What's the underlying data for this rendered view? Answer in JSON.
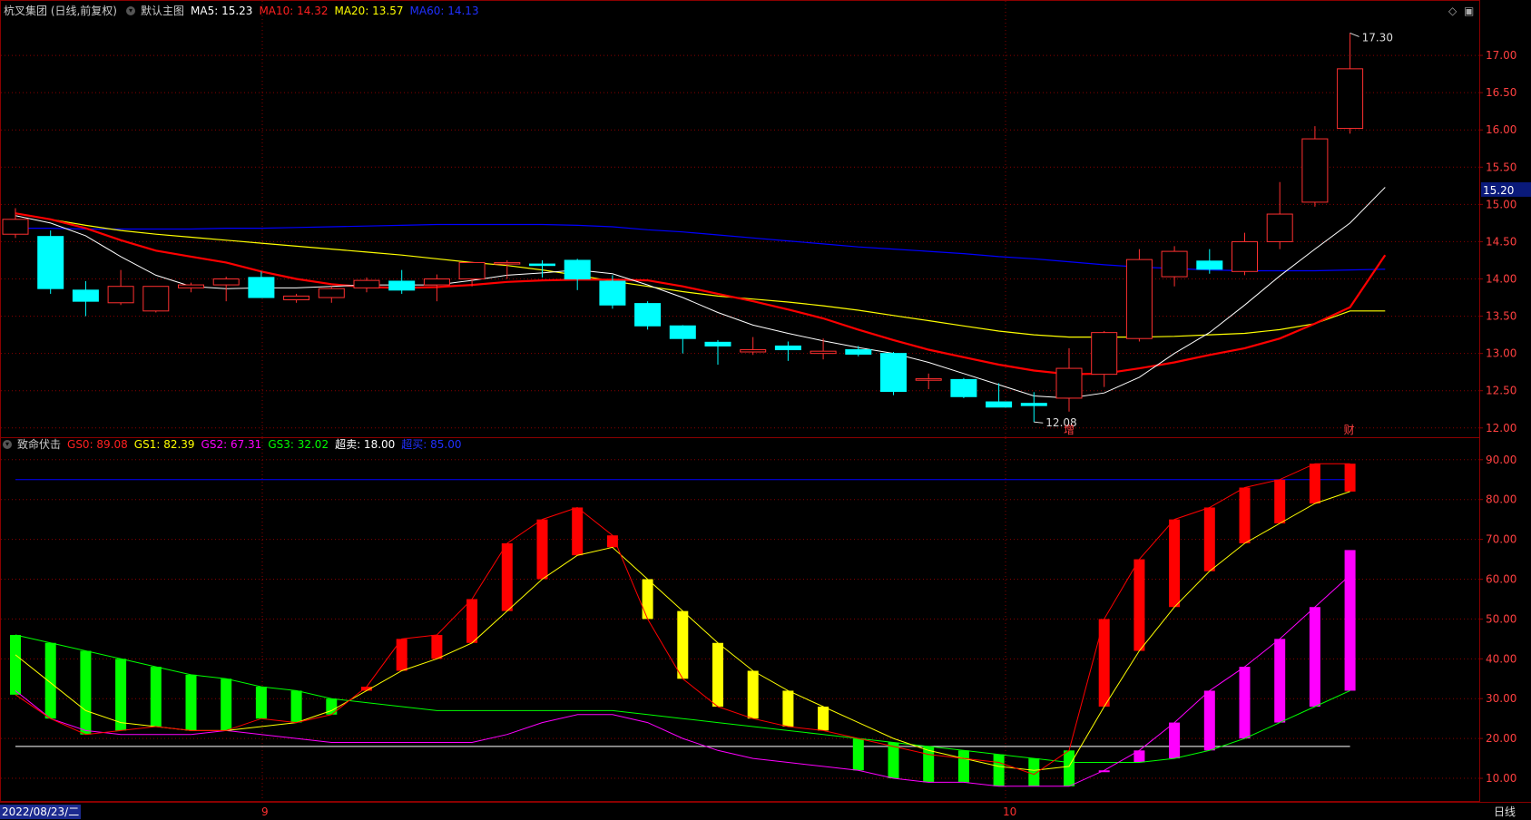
{
  "main_header": {
    "title": "杭叉集团 (日线,前复权)",
    "mode": "默认主图",
    "ma5": "MA5: 15.23",
    "ma10": "MA10: 14.32",
    "ma20": "MA20: 13.57",
    "ma60": "MA60: 14.13"
  },
  "sub_header": {
    "title": "致命伏击",
    "gs0": "GS0: 89.08",
    "gs1": "GS1: 82.39",
    "gs2": "GS2: 67.31",
    "gs3": "GS3: 32.02",
    "oversold": "超卖: 18.00",
    "overbought": "超买: 85.00"
  },
  "bottom": {
    "date_label": "2022/08/23/二",
    "month_9": "9",
    "month_10": "10",
    "period": "日线"
  },
  "colors": {
    "up": "#ff3030",
    "down": "#00ffff",
    "ma5": "#ffffff",
    "ma10": "#ff0000",
    "ma20": "#ffff00",
    "ma60": "#0000ff",
    "gs_green": "#00ff00",
    "gs_yellow": "#ffff00",
    "gs_red": "#ff0000",
    "gs_magenta": "#ff00ff",
    "grid": "#8a0000"
  },
  "chart_data": {
    "type": "candlestick",
    "price_axis": {
      "ticks": [
        "12.00",
        "12.50",
        "13.00",
        "13.50",
        "14.00",
        "14.50",
        "15.00",
        "15.50",
        "16.00",
        "16.50",
        "17.00"
      ],
      "range": [
        11.9,
        17.5
      ],
      "current_price_tag": "15.20",
      "high_label": "17.30",
      "low_label": "12.08",
      "markers": [
        "增",
        "财"
      ]
    },
    "candles": [
      {
        "o": 14.6,
        "h": 14.95,
        "l": 14.55,
        "c": 14.8
      },
      {
        "o": 14.57,
        "h": 14.65,
        "l": 13.8,
        "c": 13.87
      },
      {
        "o": 13.85,
        "h": 13.97,
        "l": 13.5,
        "c": 13.7
      },
      {
        "o": 13.68,
        "h": 14.12,
        "l": 13.65,
        "c": 13.9
      },
      {
        "o": 13.57,
        "h": 13.9,
        "l": 13.55,
        "c": 13.9
      },
      {
        "o": 13.88,
        "h": 13.95,
        "l": 13.82,
        "c": 13.92
      },
      {
        "o": 13.92,
        "h": 14.03,
        "l": 13.7,
        "c": 14.0
      },
      {
        "o": 14.02,
        "h": 14.1,
        "l": 13.75,
        "c": 13.75
      },
      {
        "o": 13.72,
        "h": 13.8,
        "l": 13.68,
        "c": 13.77
      },
      {
        "o": 13.75,
        "h": 13.9,
        "l": 13.68,
        "c": 13.87
      },
      {
        "o": 13.88,
        "h": 14.02,
        "l": 13.82,
        "c": 13.98
      },
      {
        "o": 13.97,
        "h": 14.12,
        "l": 13.8,
        "c": 13.85
      },
      {
        "o": 13.92,
        "h": 14.06,
        "l": 13.7,
        "c": 14.0
      },
      {
        "o": 14.0,
        "h": 14.23,
        "l": 13.9,
        "c": 14.22
      },
      {
        "o": 14.2,
        "h": 14.25,
        "l": 14.0,
        "c": 14.22
      },
      {
        "o": 14.2,
        "h": 14.25,
        "l": 14.02,
        "c": 14.18
      },
      {
        "o": 14.25,
        "h": 14.27,
        "l": 13.85,
        "c": 14.0
      },
      {
        "o": 13.97,
        "h": 14.05,
        "l": 13.6,
        "c": 13.65
      },
      {
        "o": 13.67,
        "h": 13.7,
        "l": 13.32,
        "c": 13.37
      },
      {
        "o": 13.37,
        "h": 13.38,
        "l": 13.0,
        "c": 13.2
      },
      {
        "o": 13.15,
        "h": 13.18,
        "l": 12.85,
        "c": 13.1
      },
      {
        "o": 13.02,
        "h": 13.22,
        "l": 12.98,
        "c": 13.05
      },
      {
        "o": 13.1,
        "h": 13.16,
        "l": 12.9,
        "c": 13.05
      },
      {
        "o": 13.0,
        "h": 13.2,
        "l": 12.92,
        "c": 13.03
      },
      {
        "o": 13.05,
        "h": 13.1,
        "l": 12.96,
        "c": 12.99
      },
      {
        "o": 13.0,
        "h": 13.02,
        "l": 12.44,
        "c": 12.49
      },
      {
        "o": 12.64,
        "h": 12.73,
        "l": 12.52,
        "c": 12.66
      },
      {
        "o": 12.65,
        "h": 12.67,
        "l": 12.4,
        "c": 12.42
      },
      {
        "o": 12.35,
        "h": 12.6,
        "l": 12.28,
        "c": 12.28
      },
      {
        "o": 12.33,
        "h": 12.48,
        "l": 12.08,
        "c": 12.3
      },
      {
        "o": 12.4,
        "h": 13.07,
        "l": 12.22,
        "c": 12.8
      },
      {
        "o": 12.72,
        "h": 13.3,
        "l": 12.55,
        "c": 13.28
      },
      {
        "o": 13.2,
        "h": 14.4,
        "l": 13.16,
        "c": 14.26
      },
      {
        "o": 14.03,
        "h": 14.44,
        "l": 13.9,
        "c": 14.37
      },
      {
        "o": 14.24,
        "h": 14.4,
        "l": 14.07,
        "c": 14.13
      },
      {
        "o": 14.1,
        "h": 14.62,
        "l": 14.05,
        "c": 14.5
      },
      {
        "o": 14.5,
        "h": 15.3,
        "l": 14.4,
        "c": 14.87
      },
      {
        "o": 15.03,
        "h": 16.05,
        "l": 14.97,
        "c": 15.88
      },
      {
        "o": 16.02,
        "h": 17.3,
        "l": 15.95,
        "c": 16.82
      }
    ],
    "ma5": [
      14.85,
      14.75,
      14.58,
      14.3,
      14.05,
      13.9,
      13.87,
      13.88,
      13.88,
      13.9,
      13.92,
      13.92,
      13.92,
      13.98,
      14.05,
      14.08,
      14.12,
      14.07,
      13.92,
      13.75,
      13.55,
      13.38,
      13.27,
      13.17,
      13.08,
      13.0,
      12.88,
      12.73,
      12.58,
      12.43,
      12.4,
      12.47,
      12.68,
      13.0,
      13.28,
      13.65,
      14.04,
      14.4,
      14.75,
      15.23
    ],
    "ma10": [
      14.88,
      14.8,
      14.68,
      14.52,
      14.38,
      14.3,
      14.22,
      14.1,
      14.0,
      13.93,
      13.89,
      13.88,
      13.89,
      13.92,
      13.96,
      13.98,
      13.99,
      13.99,
      13.98,
      13.9,
      13.8,
      13.7,
      13.59,
      13.47,
      13.32,
      13.18,
      13.05,
      12.95,
      12.85,
      12.77,
      12.72,
      12.73,
      12.8,
      12.88,
      12.98,
      13.07,
      13.2,
      13.4,
      13.62,
      14.32
    ],
    "ma20": [
      14.88,
      14.8,
      14.72,
      14.65,
      14.6,
      14.56,
      14.52,
      14.48,
      14.44,
      14.4,
      14.36,
      14.32,
      14.27,
      14.22,
      14.18,
      14.12,
      14.05,
      13.97,
      13.9,
      13.83,
      13.77,
      13.73,
      13.69,
      13.64,
      13.58,
      13.51,
      13.44,
      13.37,
      13.3,
      13.25,
      13.22,
      13.22,
      13.22,
      13.23,
      13.25,
      13.27,
      13.32,
      13.4,
      13.57,
      13.57
    ],
    "ma60": [
      14.68,
      14.68,
      14.67,
      14.67,
      14.67,
      14.67,
      14.68,
      14.68,
      14.69,
      14.7,
      14.71,
      14.72,
      14.73,
      14.73,
      14.73,
      14.73,
      14.72,
      14.7,
      14.66,
      14.63,
      14.59,
      14.55,
      14.51,
      14.47,
      14.43,
      14.4,
      14.37,
      14.34,
      14.3,
      14.27,
      14.23,
      14.19,
      14.16,
      14.14,
      14.12,
      14.11,
      14.11,
      14.11,
      14.12,
      14.13
    ],
    "indicator": {
      "axis_ticks": [
        "10.00",
        "20.00",
        "30.00",
        "40.00",
        "50.00",
        "60.00",
        "70.00",
        "80.00",
        "90.00"
      ],
      "range": [
        5,
        92
      ],
      "oversold": 18,
      "overbought": 85,
      "gs0": [
        31,
        25,
        21,
        22,
        23,
        22,
        22,
        25,
        24,
        26,
        33,
        45,
        46,
        55,
        69,
        75,
        78,
        71,
        50,
        35,
        28,
        25,
        23,
        22,
        20,
        18,
        16,
        15,
        14,
        11,
        17,
        50,
        65,
        75,
        78,
        83,
        85,
        89,
        89
      ],
      "gs1": [
        41,
        34,
        27,
        24,
        23,
        22,
        22,
        23,
        24,
        27,
        32,
        37,
        40,
        44,
        52,
        60,
        66,
        68,
        60,
        52,
        44,
        37,
        32,
        28,
        24,
        20,
        17,
        15,
        13,
        12,
        13,
        28,
        42,
        53,
        62,
        69,
        74,
        79,
        82
      ],
      "gs2": [
        32,
        25,
        22,
        21,
        21,
        21,
        22,
        21,
        20,
        19,
        19,
        19,
        19,
        19,
        21,
        24,
        26,
        26,
        24,
        20,
        17,
        15,
        14,
        13,
        12,
        10,
        9,
        9,
        8,
        8,
        8,
        12,
        17,
        24,
        32,
        38,
        45,
        53,
        61
      ],
      "gs3": [
        46,
        44,
        42,
        40,
        38,
        36,
        35,
        33,
        32,
        30,
        29,
        28,
        27,
        27,
        27,
        27,
        27,
        27,
        26,
        25,
        24,
        23,
        22,
        21,
        20,
        19,
        18,
        17,
        16,
        15,
        14,
        14,
        14,
        15,
        17,
        20,
        24,
        28,
        32
      ],
      "gs2_last": 67.31,
      "gs3_last": 32.02
    }
  }
}
